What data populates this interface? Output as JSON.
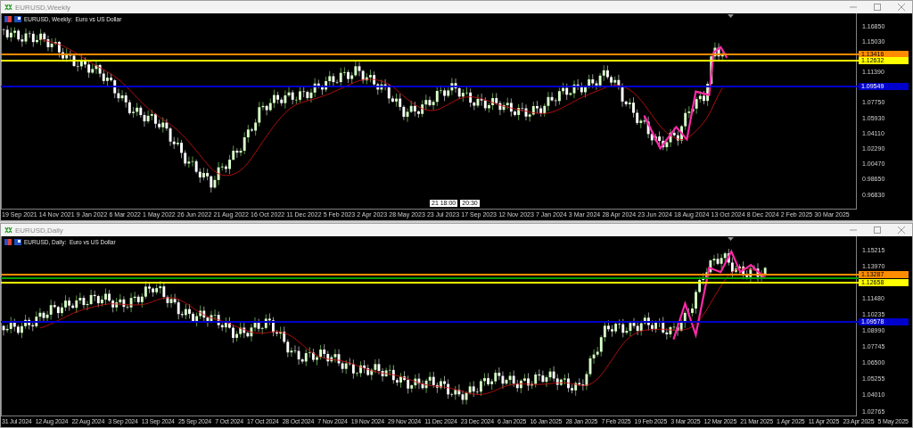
{
  "windows": [
    {
      "title": "EURUSD,Weekly",
      "legend": "EURUSD, Weekly:  Euro vs US Dollar",
      "price_ticks": [
        "1.16850",
        "1.15030",
        "1.11390",
        "1.07750",
        "1.05930",
        "1.04110",
        "1.02290",
        "1.00470",
        "0.98650",
        "0.96830"
      ],
      "price_tags": [
        {
          "text": "1.13416",
          "color": "#ff8c00"
        },
        {
          "text": "1.12632",
          "color": "#ffff00"
        },
        {
          "text": "1.09549",
          "color": "#0000cd"
        }
      ],
      "time_ticks": [
        "19 Sep 2021",
        "14 Nov 2021",
        "9 Jan 2022",
        "6 Mar 2022",
        "1 May 2022",
        "26 Jun 2022",
        "21 Aug 2022",
        "16 Oct 2022",
        "11 Dec 2022",
        "5 Feb 2023",
        "2 Apr 2023",
        "28 May 2023",
        "23 Jul 2023",
        "17 Sep 2023",
        "12 Nov 2023",
        "7 Jan 2024",
        "3 Mar 2024",
        "28 Apr 2024",
        "23 Jun 2024",
        "18 Aug 2024",
        "13 Oct 2024",
        "8 Dec 2024",
        "2 Feb 2025",
        "30 Mar 2025"
      ],
      "crosshair_labels": [
        "21 18:00",
        "20:30"
      ]
    },
    {
      "title": "EURUSD,Daily",
      "legend": "EURUSD, Daily:  Euro vs US Dollar",
      "price_ticks": [
        "1.15215",
        "1.13970",
        "1.11480",
        "1.10235",
        "1.08990",
        "1.07745",
        "1.06500",
        "1.05255",
        "1.04010",
        "1.02765"
      ],
      "price_tags": [
        {
          "text": "1.13287",
          "color": "#ff8c00"
        },
        {
          "color": "#00a000"
        },
        {
          "text": "1.12658",
          "color": "#ffff00"
        },
        {
          "text": "1.09578",
          "color": "#0000cd"
        }
      ],
      "time_ticks": [
        "31 Jul 2024",
        "12 Aug 2024",
        "22 Aug 2024",
        "3 Sep 2024",
        "13 Sep 2024",
        "25 Sep 2024",
        "7 Oct 2024",
        "17 Oct 2024",
        "28 Oct 2024",
        "7 Nov 2024",
        "19 Nov 2024",
        "29 Nov 2024",
        "11 Dec 2024",
        "23 Dec 2024",
        "6 Jan 2025",
        "16 Jan 2025",
        "28 Jan 2025",
        "7 Feb 2025",
        "19 Feb 2025",
        "3 Mar 2025",
        "12 Mar 2025",
        "21 Mar 2025",
        "1 Apr 2025",
        "11 Apr 2025",
        "23 Apr 2025",
        "5 May 2025"
      ]
    }
  ]
}
